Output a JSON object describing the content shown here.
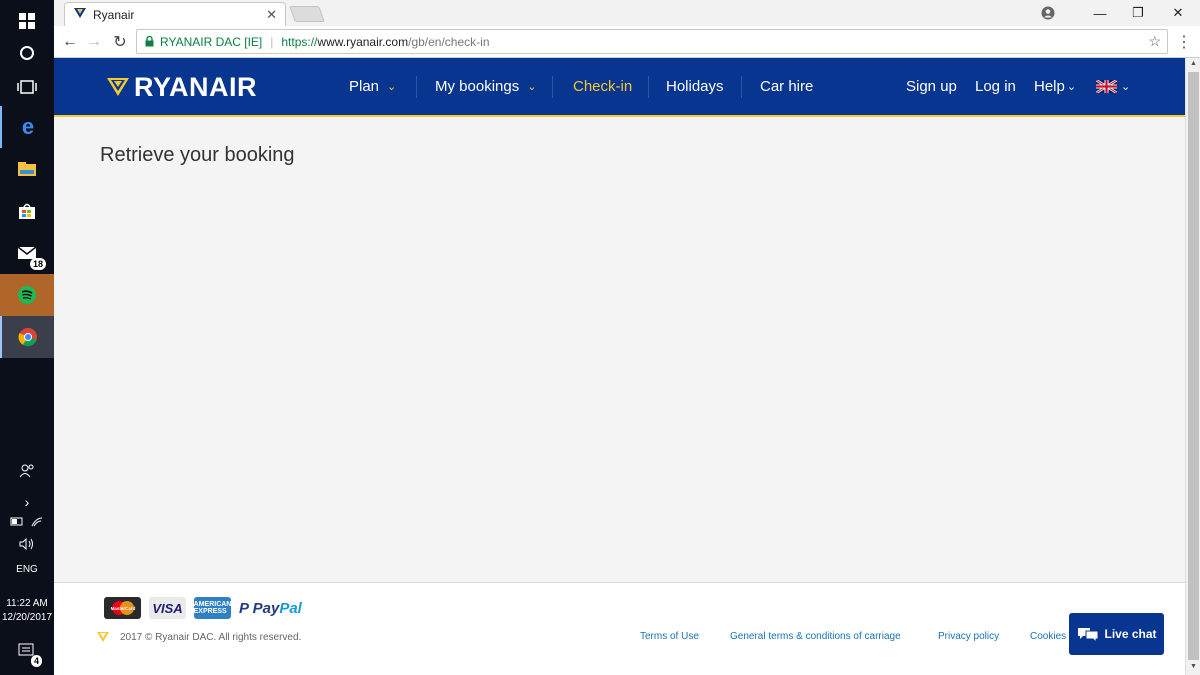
{
  "taskbar": {
    "mail_badge": "18",
    "notifications_badge": "4",
    "language": "ENG",
    "time": "11:22 AM",
    "date": "12/20/2017"
  },
  "browser": {
    "tab_title": "Ryanair",
    "secure_label": "RYANAIR DAC [IE]",
    "url_scheme": "https://",
    "url_host": "www.ryanair.com",
    "url_path": "/gb/en/check-in"
  },
  "header": {
    "logo_text": "RYANAIR",
    "nav": [
      {
        "label": "Plan",
        "has_dropdown": true
      },
      {
        "label": "My bookings",
        "has_dropdown": true
      },
      {
        "label": "Check-in",
        "active": true
      },
      {
        "label": "Holidays"
      },
      {
        "label": "Car hire"
      }
    ],
    "sign_up": "Sign up",
    "log_in": "Log in",
    "help": "Help",
    "language_flag": "uk-flag-icon"
  },
  "main": {
    "title": "Retrieve your booking"
  },
  "footer": {
    "payment_cards": [
      "MasterCard",
      "VISA",
      "AMERICAN EXPRESS"
    ],
    "paypal_pay": "Pay",
    "paypal_pal": "Pal",
    "copyright": "2017 © Ryanair DAC. All rights reserved.",
    "links": [
      "Terms of Use",
      "General terms & conditions of carriage",
      "Privacy policy",
      "Cookies"
    ],
    "live_chat": "Live chat"
  },
  "colors": {
    "brand_blue": "#073590",
    "brand_yellow": "#f1c933",
    "link_blue": "#1a73b8"
  }
}
